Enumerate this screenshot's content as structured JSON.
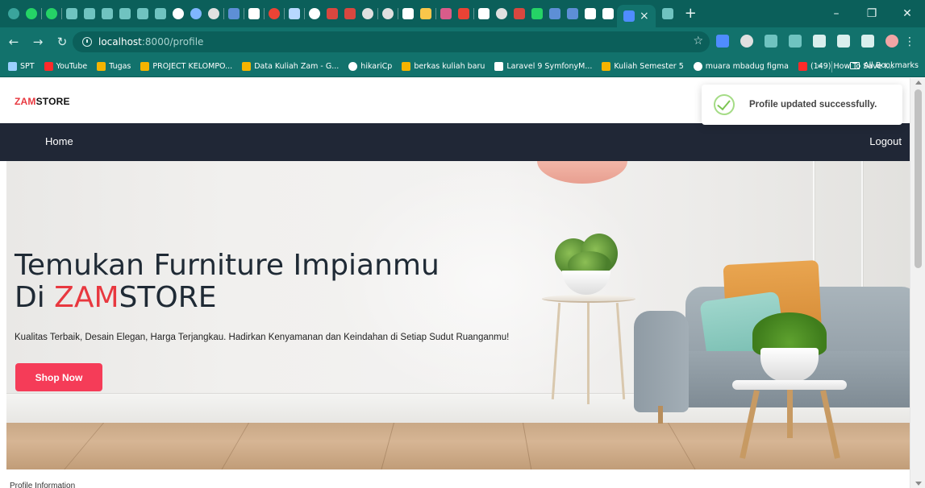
{
  "browser": {
    "url_host": "localhost",
    "url_path": ":8000/profile",
    "tab_close_label": "×",
    "new_tab_label": "+",
    "window_minimize": "–",
    "window_restore": "❐",
    "window_close": "✕",
    "bookmarks": [
      {
        "label": "SPT",
        "icon": "bookmark-icon",
        "color": "#9bd0ff"
      },
      {
        "label": "YouTube",
        "icon": "youtube-icon",
        "color": "#ff2a2a"
      },
      {
        "label": "Tugas",
        "icon": "drive-icon",
        "color": "#f4b400"
      },
      {
        "label": "PROJECT KELOMPO...",
        "icon": "drive-icon",
        "color": "#f4b400"
      },
      {
        "label": "Data Kuliah Zam - G...",
        "icon": "drive-icon",
        "color": "#f4b400"
      },
      {
        "label": "hikariCp",
        "icon": "github-icon",
        "color": "#ffffff"
      },
      {
        "label": "berkas kuliah baru",
        "icon": "drive-icon",
        "color": "#f4b400"
      },
      {
        "label": "Laravel 9 SymfonyM...",
        "icon": "laravel-icon",
        "color": "#ffffff"
      },
      {
        "label": "Kuliah Semester 5",
        "icon": "drive-icon",
        "color": "#f4b400"
      },
      {
        "label": "muara mbadug figma",
        "icon": "google-icon",
        "color": "#ffffff"
      },
      {
        "label": "(149) How To Save I...",
        "icon": "youtube-icon",
        "color": "#ff2a2a"
      }
    ],
    "bookmarks_more": "»",
    "all_bookmarks": "All Bookmarks"
  },
  "site": {
    "brand_red": "ZAM",
    "brand_dark": "STORE",
    "nav_home": "Home",
    "nav_logout": "Logout"
  },
  "hero": {
    "title_line1": "Temukan Furniture Impianmu",
    "title_line2_prefix": "Di ",
    "title_line2_red": "ZAM",
    "title_line2_rest": "STORE",
    "subtitle": "Kualitas Terbaik, Desain Elegan, Harga Terjangkau. Hadirkan Kenyamanan dan Keindahan di Setiap Sudut Ruanganmu!",
    "button_label": "Shop Now"
  },
  "profile_section_label": "Profile Information",
  "toast": {
    "message": "Profile updated successfully.",
    "icon": "check-icon",
    "icon_color": "#a5dc86"
  },
  "colors": {
    "accent_red": "#e8383f",
    "button_red": "#f53c58",
    "nav_bg": "#202736",
    "browser_teal": "#12726c"
  }
}
